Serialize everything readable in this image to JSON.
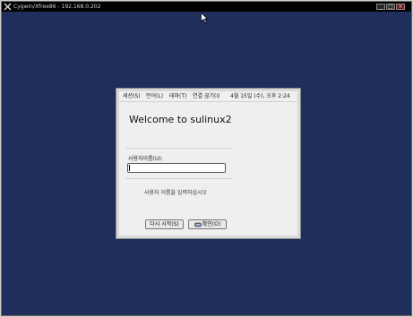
{
  "window": {
    "title": "Cygwin/Xfree86 - 192.168.0.202",
    "controls": [
      "_",
      "□",
      "×"
    ]
  },
  "menubar": {
    "session": "세션(S)",
    "language": "언어(L)",
    "theme": "테마(T)",
    "disconnect": "연결 끊기(I)",
    "clock": "4월 15일 (수), 오후  2:24"
  },
  "login": {
    "welcome": "Welcome to sulinux2",
    "username_label": "사용자이름(U):",
    "username_value": "",
    "prompt": "사용자 이름을 입력하십시오",
    "restart_button": "다시 시작(S)",
    "ok_button": "확인(O)"
  },
  "colors": {
    "desktop": "#1f2e5a",
    "dialog": "#efefef",
    "titlebar": "#000000"
  },
  "icons": [
    "cygwin-x-icon",
    "mouse-pointer-icon",
    "key-icon"
  ]
}
